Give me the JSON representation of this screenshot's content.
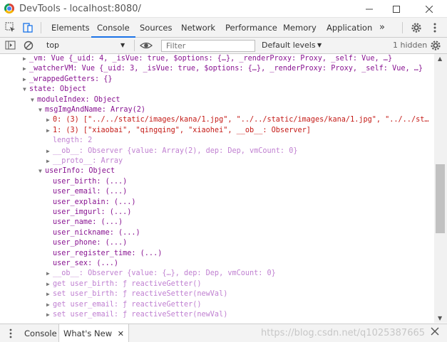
{
  "window": {
    "title": "DevTools - localhost:8080/",
    "minimize_icon": "minimize-icon",
    "maximize_icon": "maximize-icon",
    "close_icon": "close-icon"
  },
  "tabs": [
    {
      "label": "Elements"
    },
    {
      "label": "Console"
    },
    {
      "label": "Sources"
    },
    {
      "label": "Network"
    },
    {
      "label": "Performance"
    },
    {
      "label": "Memory"
    },
    {
      "label": "Application"
    },
    {
      "label": "»"
    }
  ],
  "toolbar": {
    "context": "top",
    "filter_placeholder": "Filter",
    "levels": "Default levels",
    "hidden_count": "1 hidden"
  },
  "console_lines": [
    "_vm: Vue {_uid: 4, _isVue: true, $options: {…}, _renderProxy: Proxy, _self: Vue, …}",
    "_watcherVM: Vue {_uid: 3, _isVue: true, $options: {…}, _renderProxy: Proxy, _self: Vue, …}",
    "_wrappedGetters: {}",
    "state: Object",
    "moduleIndex: Object",
    "msgImgAndName: Array(2)",
    "0: (3) [\"../../static/images/kana/1.jpg\", \"../../static/images/kana/1.jpg\", \"../../st…",
    "1: (3) [\"xiaobai\", \"qingqing\", \"xiaohei\", __ob__: Observer]",
    "length: 2",
    "__ob__: Observer {value: Array(2), dep: Dep, vmCount: 0}",
    "__proto__: Array",
    "userInfo: Object",
    "user_birth: (...)",
    "user_email: (...)",
    "user_explain: (...)",
    "user_imgurl: (...)",
    "user_name: (...)",
    "user_nickname: (...)",
    "user_phone: (...)",
    "user_register_time: (...)",
    "user_sex: (...)",
    "__ob__: Observer {value: {…}, dep: Dep, vmCount: 0}",
    "get user_birth: ƒ reactiveGetter()",
    "set user_birth: ƒ reactiveSetter(newVal)",
    "get user_email: ƒ reactiveGetter()",
    "set user_email: ƒ reactiveSetter(newVal)"
  ],
  "drawer": {
    "console_tab": "Console",
    "whats_new_tab": "What's New",
    "watermark": "https://blog.csdn.net/q1025387665"
  }
}
